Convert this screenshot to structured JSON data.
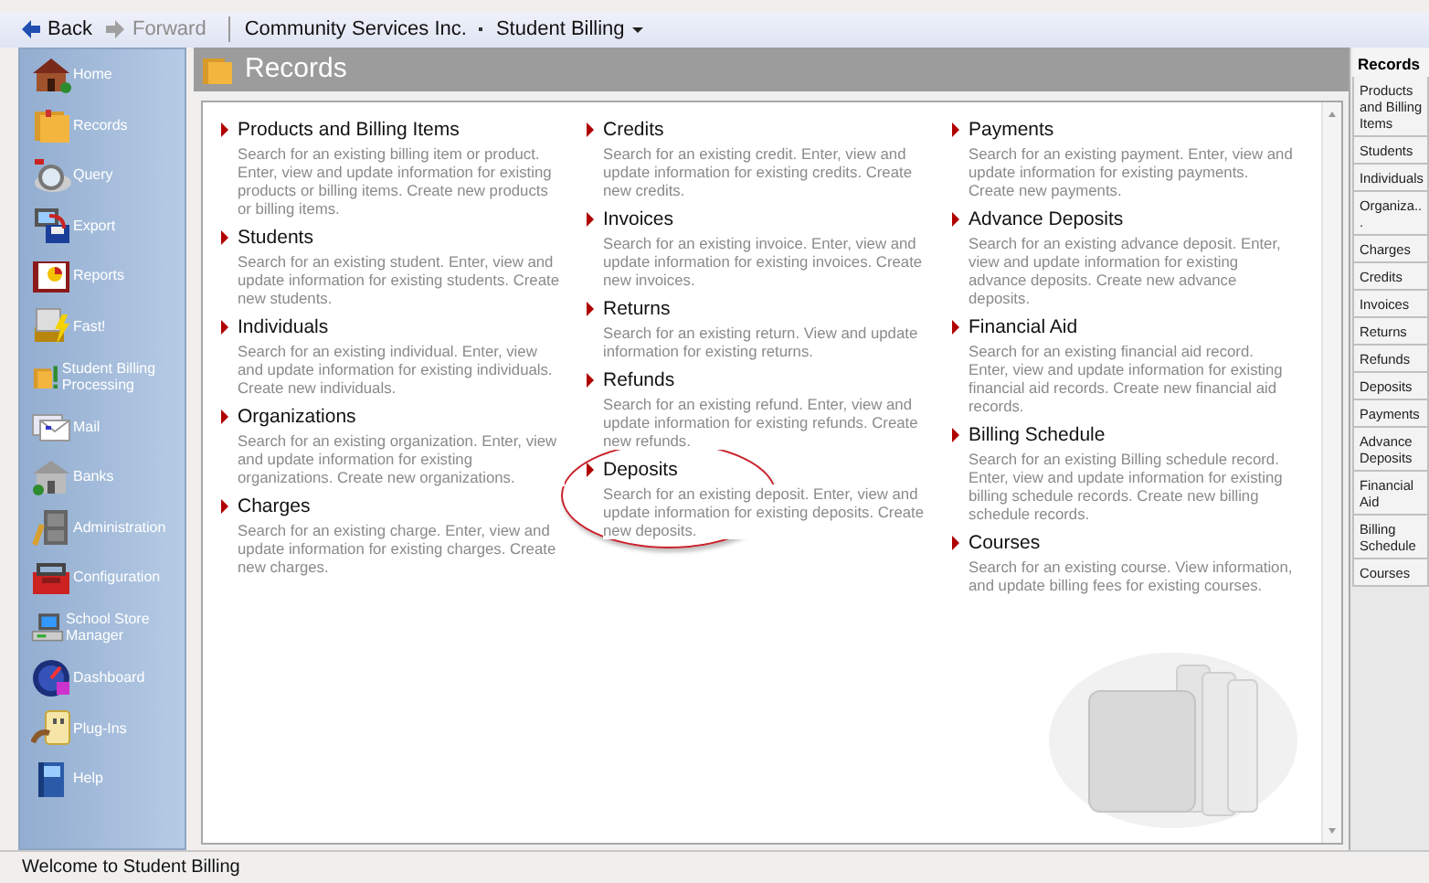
{
  "nav": {
    "buttons": [
      {
        "label": "Back",
        "disabled": false
      },
      {
        "label": "Forward",
        "disabled": true
      }
    ],
    "breadcrumb": [
      "Community Services Inc.",
      "Student Billing"
    ]
  },
  "sidebar": {
    "items": [
      {
        "label": "Home"
      },
      {
        "label": "Records"
      },
      {
        "label": "Query"
      },
      {
        "label": "Export"
      },
      {
        "label": "Reports"
      },
      {
        "label": "Fast!"
      },
      {
        "label": "Student Billing Processing"
      },
      {
        "label": "Mail"
      },
      {
        "label": "Banks"
      },
      {
        "label": "Administration"
      },
      {
        "label": "Configuration"
      },
      {
        "label": "School Store Manager"
      },
      {
        "label": "Dashboard"
      },
      {
        "label": "Plug-Ins"
      },
      {
        "label": "Help"
      }
    ]
  },
  "panel": {
    "title": "Records",
    "columns": [
      [
        {
          "title": "Products and Billing Items",
          "description": "Search for an existing billing item or product. Enter, view and update information for existing products or billing items. Create new products or billing items.",
          "circled": false
        },
        {
          "title": "Students",
          "description": "Search for an existing student. Enter, view and update information for existing students. Create new students.",
          "circled": false
        },
        {
          "title": "Individuals",
          "description": "Search for an existing individual. Enter, view and update information for existing individuals. Create new individuals.",
          "circled": false
        },
        {
          "title": "Organizations",
          "description": "Search for an existing organization. Enter, view and update information for existing organizations. Create new organizations.",
          "circled": false
        },
        {
          "title": "Charges",
          "description": "Search for an existing charge. Enter, view and update information for existing charges. Create new charges.",
          "circled": false
        }
      ],
      [
        {
          "title": "Credits",
          "description": "Search for an existing credit. Enter, view and update information for existing credits. Create new credits.",
          "circled": false
        },
        {
          "title": "Invoices",
          "description": "Search for an existing invoice. Enter, view and update information for existing invoices. Create new invoices.",
          "circled": false
        },
        {
          "title": "Returns",
          "description": "Search for an existing return. View and update information for existing returns.",
          "circled": false
        },
        {
          "title": "Refunds",
          "description": "Search for an existing refund. Enter, view and update information for existing refunds. Create new refunds.",
          "circled": false
        },
        {
          "title": "Deposits",
          "description": "Search for an existing deposit. Enter, view and update information for existing deposits. Create new deposits.",
          "circled": true
        }
      ],
      [
        {
          "title": "Payments",
          "description": "Search for an existing payment. Enter, view and update information for existing payments. Create new payments.",
          "circled": false
        },
        {
          "title": "Advance Deposits",
          "description": "Search for an existing advance deposit. Enter, view and update information for existing advance deposits. Create new advance deposits.",
          "circled": false
        },
        {
          "title": "Financial Aid",
          "description": "Search for an existing financial aid record. Enter, view and update information for existing financial aid records. Create new financial aid records.",
          "circled": false
        },
        {
          "title": "Billing Schedule",
          "description": "Search for an existing Billing schedule record. Enter, view and update information for existing billing schedule records. Create new billing schedule records.",
          "circled": false
        },
        {
          "title": "Courses",
          "description": "Search for an existing course. View information, and update billing fees for existing courses.",
          "circled": false
        }
      ]
    ]
  },
  "side_tabs": {
    "title": "Records",
    "items": [
      {
        "label": "Products and Billing Items"
      },
      {
        "label": "Students"
      },
      {
        "label": "Individuals"
      },
      {
        "label": "Organiza..."
      },
      {
        "label": "Charges"
      },
      {
        "label": "Credits"
      },
      {
        "label": "Invoices"
      },
      {
        "label": "Returns"
      },
      {
        "label": "Refunds"
      },
      {
        "label": "Deposits"
      },
      {
        "label": "Payments"
      },
      {
        "label": "Advance Deposits"
      },
      {
        "label": "Financial Aid"
      },
      {
        "label": "Billing Schedule"
      },
      {
        "label": "Courses"
      }
    ]
  },
  "status_bar": "Welcome to Student Billing"
}
